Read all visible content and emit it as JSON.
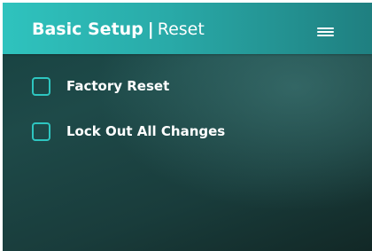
{
  "header": {
    "title_bold": "Basic Setup",
    "separator": "|",
    "title_light": "Reset",
    "menu_icon": "hamburger-menu-icon"
  },
  "options": [
    {
      "label": "Factory Reset",
      "checked": false
    },
    {
      "label": "Lock Out All Changes",
      "checked": false
    }
  ],
  "colors": {
    "accent": "#2ec6c0",
    "header_start": "#2fc3be",
    "header_end": "#1f7f80",
    "panel_bg": "#193c3b",
    "text": "#ffffff"
  }
}
